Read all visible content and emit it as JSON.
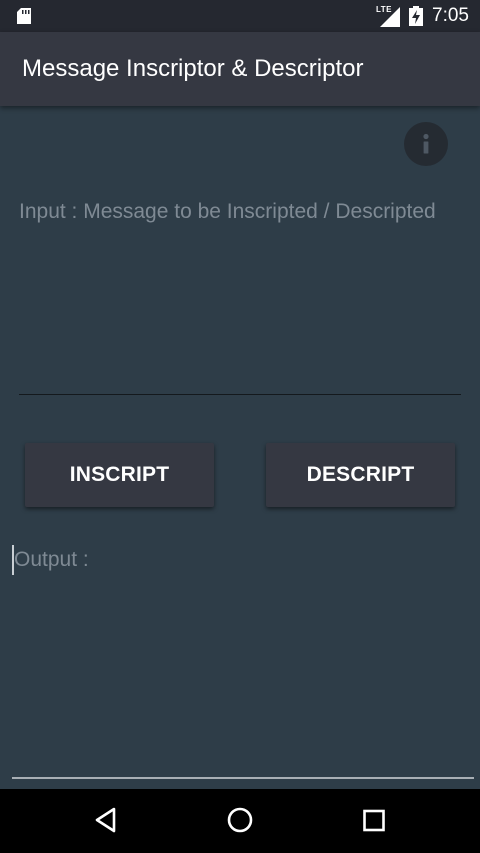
{
  "status_bar": {
    "time": "7:05",
    "network": "LTE",
    "icons": [
      "sd-card-icon",
      "signal-icon",
      "battery-charging-icon"
    ]
  },
  "app_bar": {
    "title": "Message Inscriptor & Descriptor"
  },
  "info_button": {
    "icon": "info-icon"
  },
  "input": {
    "value": "",
    "placeholder": "Input : Message to be Inscripted / Descripted"
  },
  "buttons": {
    "inscript_label": "INSCRIPT",
    "descript_label": "DESCRIPT"
  },
  "output": {
    "label": "Output :"
  },
  "nav_bar": {
    "icons": [
      "back-icon",
      "home-icon",
      "recents-icon"
    ]
  },
  "colors": {
    "background": "#2e3d48",
    "app_bar": "#353842",
    "status_bar": "#252830",
    "button": "#353842",
    "placeholder": "#7f8a94"
  }
}
